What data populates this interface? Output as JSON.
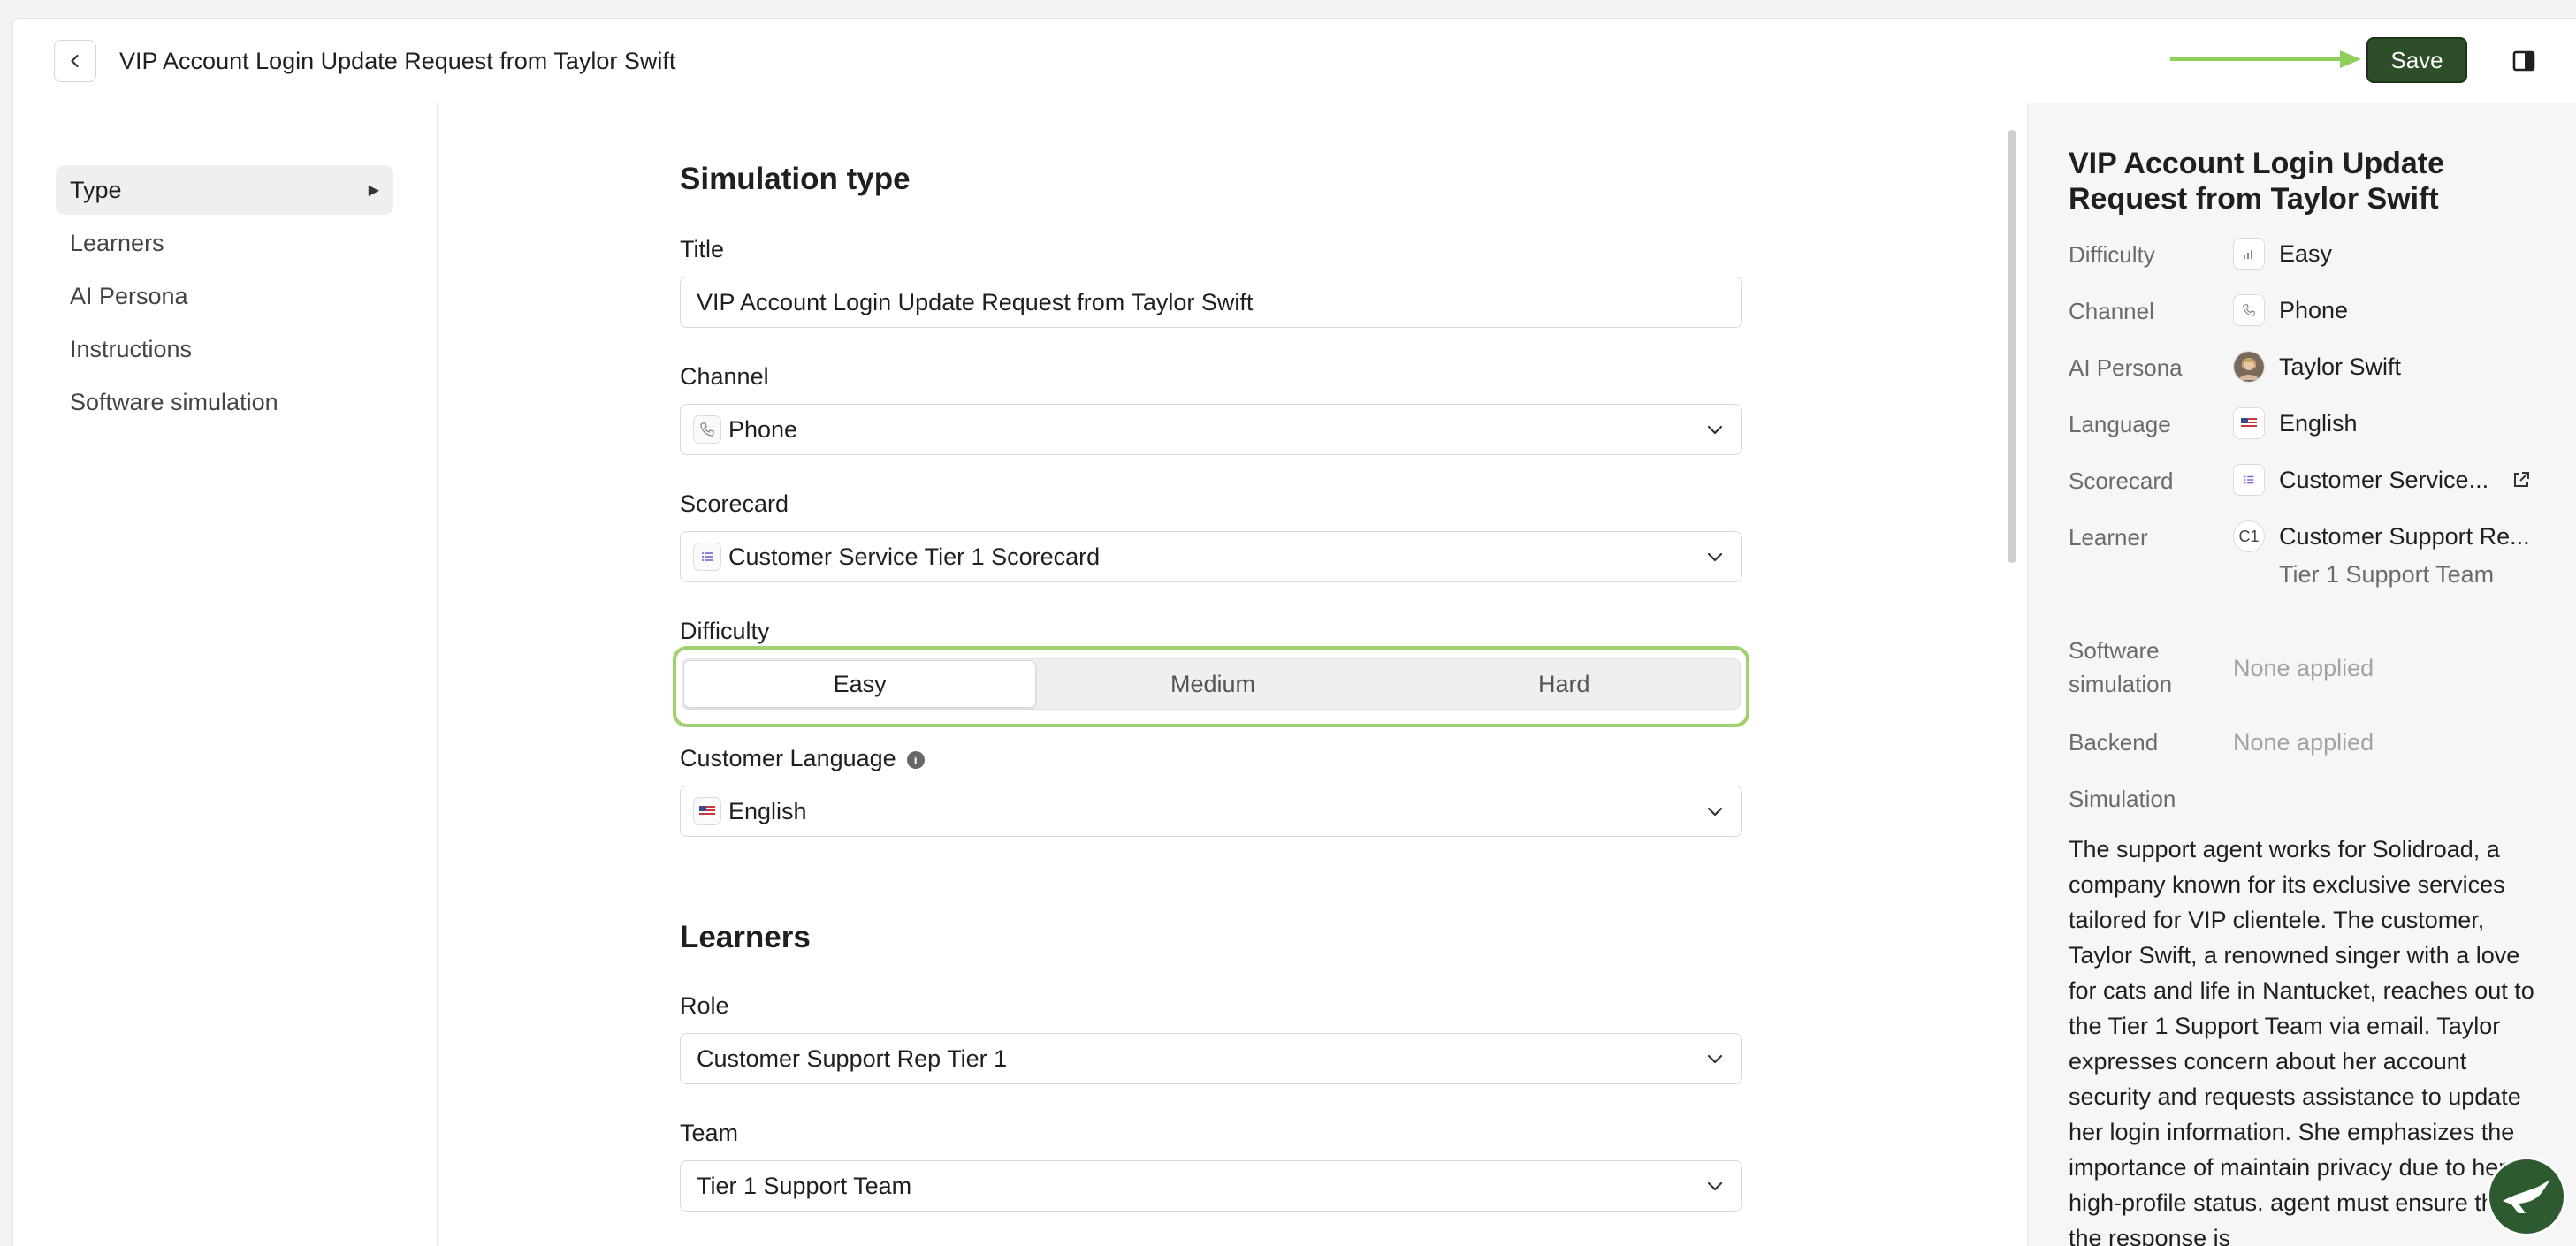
{
  "header": {
    "title": "VIP Account Login Update Request from Taylor Swift",
    "save_label": "Save"
  },
  "nav": {
    "items": [
      {
        "label": "Type",
        "active": true
      },
      {
        "label": "Learners"
      },
      {
        "label": "AI Persona"
      },
      {
        "label": "Instructions"
      },
      {
        "label": "Software simulation"
      }
    ]
  },
  "main": {
    "section_type": "Simulation type",
    "title_label": "Title",
    "title_value": "VIP Account Login Update Request from Taylor Swift",
    "channel_label": "Channel",
    "channel_value": "Phone",
    "scorecard_label": "Scorecard",
    "scorecard_value": "Customer Service Tier 1 Scorecard",
    "difficulty_label": "Difficulty",
    "difficulty_options": [
      "Easy",
      "Medium",
      "Hard"
    ],
    "difficulty_selected": "Easy",
    "language_label": "Customer Language",
    "language_value": "English",
    "section_learners": "Learners",
    "role_label": "Role",
    "role_value": "Customer Support Rep Tier 1",
    "team_label": "Team",
    "team_value": "Tier 1 Support Team"
  },
  "summary": {
    "title": "VIP Account Login Update Request from Taylor Swift",
    "difficulty_label": "Difficulty",
    "difficulty_value": "Easy",
    "channel_label": "Channel",
    "channel_value": "Phone",
    "persona_label": "AI Persona",
    "persona_value": "Taylor Swift",
    "language_label": "Language",
    "language_value": "English",
    "scorecard_label": "Scorecard",
    "scorecard_value": "Customer Service...",
    "learner_label": "Learner",
    "learner_badge": "C1",
    "learner_value": "Customer Support Re...",
    "learner_team": "Tier 1 Support Team",
    "software_label_1": "Software",
    "software_label_2": "simulation",
    "software_value": "None applied",
    "backend_label": "Backend",
    "backend_value": "None applied",
    "simulation_label": "Simulation",
    "simulation_text": "The support agent works for Solidroad, a company known for its exclusive services tailored for VIP clientele. The customer, Taylor Swift, a renowned singer with a love for cats and life in Nantucket, reaches out to the Tier 1 Support Team via email. Taylor expresses concern about her account security and requests assistance to update her login information. She emphasizes the importance of maintain privacy due to her high-profile status. agent must ensure that the response is"
  },
  "colors": {
    "accent_green": "#2e4e2a",
    "highlight_green": "#9fd26e"
  }
}
